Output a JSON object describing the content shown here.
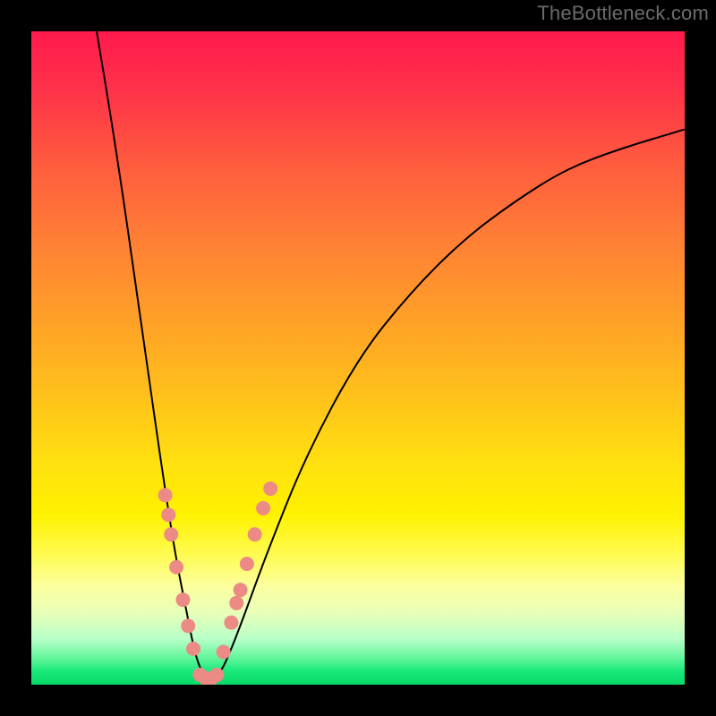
{
  "watermark": "TheBottleneck.com",
  "chart_data": {
    "type": "line",
    "title": "",
    "xlabel": "",
    "ylabel": "",
    "xlim": [
      0,
      100
    ],
    "ylim": [
      0,
      100
    ],
    "background_gradient": {
      "0": "#ff1a4c",
      "50": "#ffc21a",
      "80": "#fffb50",
      "100": "#08d968"
    },
    "series": [
      {
        "name": "bottleneck-curve",
        "color": "#000000",
        "x": [
          10,
          12,
          14,
          16,
          18,
          20,
          22,
          24,
          25,
          26,
          27,
          28,
          29,
          30,
          32,
          36,
          42,
          50,
          58,
          66,
          74,
          82,
          90,
          100
        ],
        "y": [
          100,
          88,
          75,
          61,
          47,
          33,
          20,
          10,
          5,
          2,
          1,
          1,
          2,
          4,
          9,
          20,
          35,
          50,
          60,
          68,
          74,
          79,
          82,
          85
        ]
      }
    ],
    "markers": [
      {
        "name": "dots-left-arm",
        "color": "#ec8a86",
        "points": [
          {
            "x": 20.5,
            "y": 29
          },
          {
            "x": 21.0,
            "y": 26
          },
          {
            "x": 21.4,
            "y": 23
          },
          {
            "x": 22.2,
            "y": 18
          },
          {
            "x": 23.2,
            "y": 13
          },
          {
            "x": 24.0,
            "y": 9
          },
          {
            "x": 24.8,
            "y": 5.5
          }
        ]
      },
      {
        "name": "dots-bottom",
        "color": "#ec8a86",
        "points": [
          {
            "x": 25.8,
            "y": 1.5
          },
          {
            "x": 26.7,
            "y": 1.0
          },
          {
            "x": 27.6,
            "y": 1.0
          },
          {
            "x": 28.4,
            "y": 1.5
          }
        ]
      },
      {
        "name": "dots-right-arm",
        "color": "#ec8a86",
        "points": [
          {
            "x": 29.4,
            "y": 5
          },
          {
            "x": 30.6,
            "y": 9.5
          },
          {
            "x": 31.4,
            "y": 12.5
          },
          {
            "x": 32.0,
            "y": 14.5
          },
          {
            "x": 33.0,
            "y": 18.5
          },
          {
            "x": 34.2,
            "y": 23
          },
          {
            "x": 35.5,
            "y": 27
          },
          {
            "x": 36.6,
            "y": 30
          }
        ]
      }
    ]
  }
}
